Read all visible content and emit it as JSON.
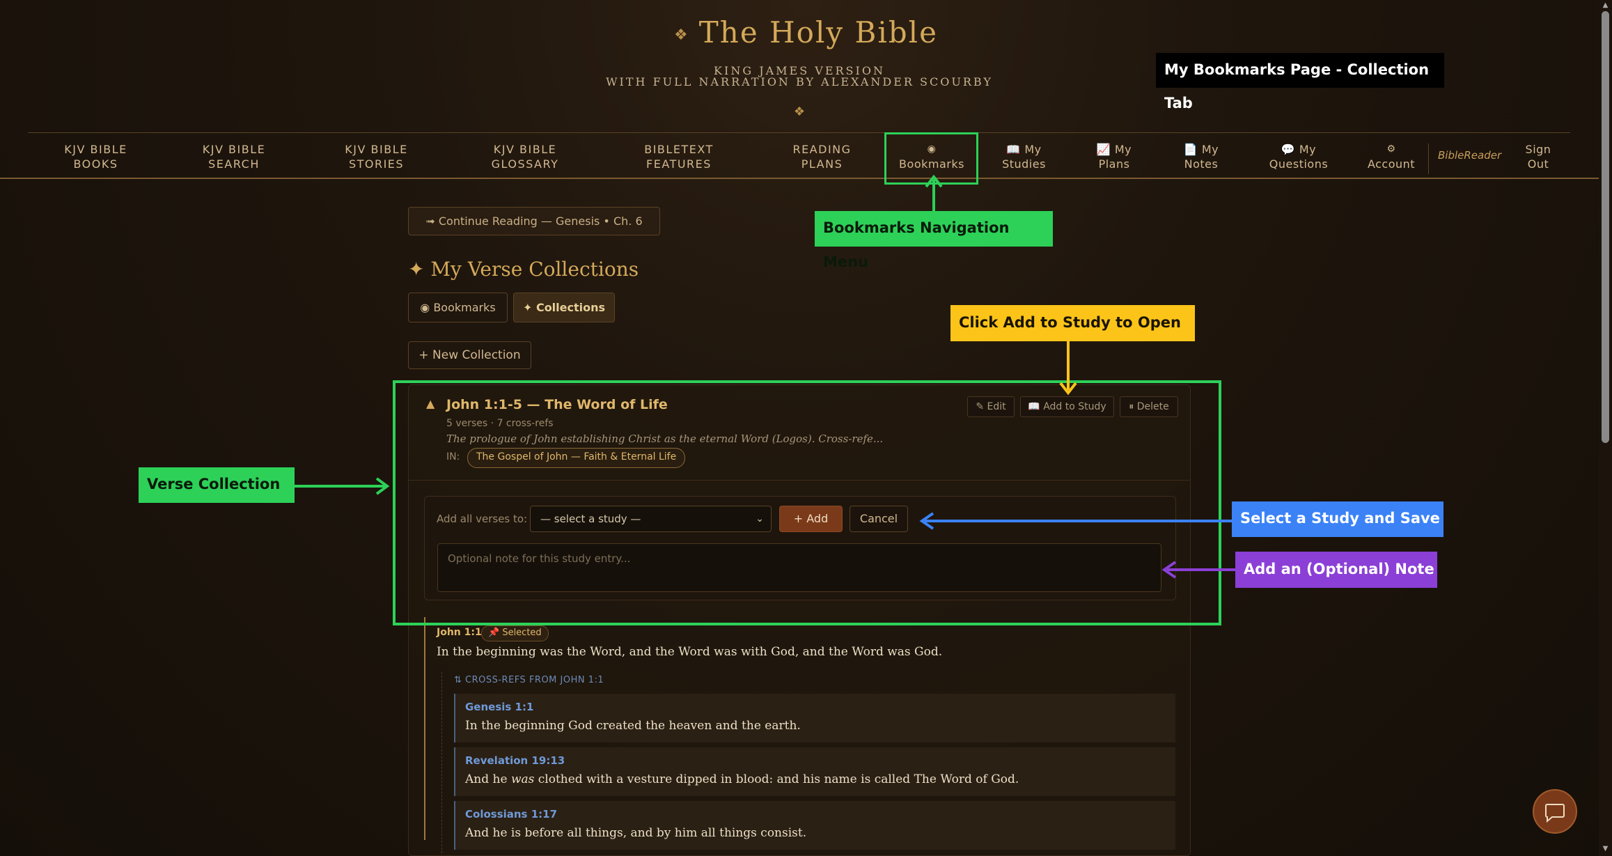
{
  "header": {
    "ornament": "❖",
    "title": "The Holy Bible",
    "subtitle_line1": "KING JAMES VERSION",
    "subtitle_line2": "WITH FULL NARRATION BY ALEXANDER SCOURBY",
    "divider_ornament": "❖"
  },
  "nav": {
    "items": [
      {
        "line1": "KJV BIBLE",
        "line2": "BOOKS"
      },
      {
        "line1": "KJV BIBLE",
        "line2": "SEARCH"
      },
      {
        "line1": "KJV BIBLE",
        "line2": "STORIES"
      },
      {
        "line1": "KJV BIBLE",
        "line2": "GLOSSARY"
      },
      {
        "line1": "BIBLETEXT",
        "line2": "FEATURES"
      },
      {
        "line1": "READING",
        "line2": "PLANS"
      },
      {
        "line1": "◉",
        "line2": "Bookmarks"
      },
      {
        "line1": "📖 My",
        "line2": "Studies"
      },
      {
        "line1": "📈 My",
        "line2": "Plans"
      },
      {
        "line1": "📄 My",
        "line2": "Notes"
      },
      {
        "line1": "💬 My",
        "line2": "Questions"
      },
      {
        "line1": "⚙",
        "line2": "Account"
      }
    ],
    "reader_label": "BibleReader",
    "signout_line1": "Sign",
    "signout_line2": "Out"
  },
  "main": {
    "continue_button": "➟ Continue Reading — Genesis • Ch. 6",
    "page_title": "✦ My Verse Collections",
    "tabs": [
      {
        "label": "◉ Bookmarks",
        "active": false
      },
      {
        "label": "✦ Collections",
        "active": true
      }
    ],
    "new_collection_button": "+ New Collection",
    "collection": {
      "caret": "▲",
      "title": "John 1:1-5 — The Word of Life",
      "meta": "5 verses · 7 cross-refs",
      "description": "The prologue of John establishing Christ as the eternal Word (Logos). Cross-refe...",
      "in_label": "IN:",
      "tag": "The Gospel of John — Faith & Eternal Life",
      "actions": {
        "edit": "✎ Edit",
        "add_to_study": "📖 Add to Study",
        "delete": "⏸ Delete"
      },
      "add_panel": {
        "label": "Add all verses to:",
        "select_value": "— select a study —",
        "add_button": "+ Add",
        "cancel_button": "Cancel",
        "note_placeholder": "Optional note for this study entry..."
      },
      "verse": {
        "ref": "John 1:1",
        "badge": "📌 Selected",
        "text": "In the beginning was the Word, and the Word was with God, and the Word was God."
      },
      "crossrefs_heading": "⇅ CROSS-REFS FROM JOHN 1:1",
      "crossrefs": [
        {
          "ref": "Genesis 1:1",
          "text": "In the beginning God created the heaven and the earth."
        },
        {
          "ref": "Revelation 19:13",
          "text_before": "And he ",
          "text_italic": "was",
          "text_after": " clothed with a vesture dipped in blood: and his name is called The Word of God."
        },
        {
          "ref": "Colossians 1:17",
          "text": "And he is before all things, and by him all things consist."
        }
      ]
    }
  },
  "annotations": {
    "page_label": "My Bookmarks Page - Collection Tab",
    "nav_menu": "Bookmarks Navigation Menu",
    "add_to_study": "Click Add to Study to Open",
    "verse_collection": "Verse Collection",
    "select_study": "Select a Study and Save",
    "optional_note": "Add an (Optional) Note",
    "colors": {
      "green": "#2dd158",
      "yellow": "#fcc419",
      "blue": "#3b82f6",
      "purple": "#8b3fd6",
      "black": "#000000"
    }
  },
  "icons": {
    "chat": "chat-bubble-icon"
  }
}
